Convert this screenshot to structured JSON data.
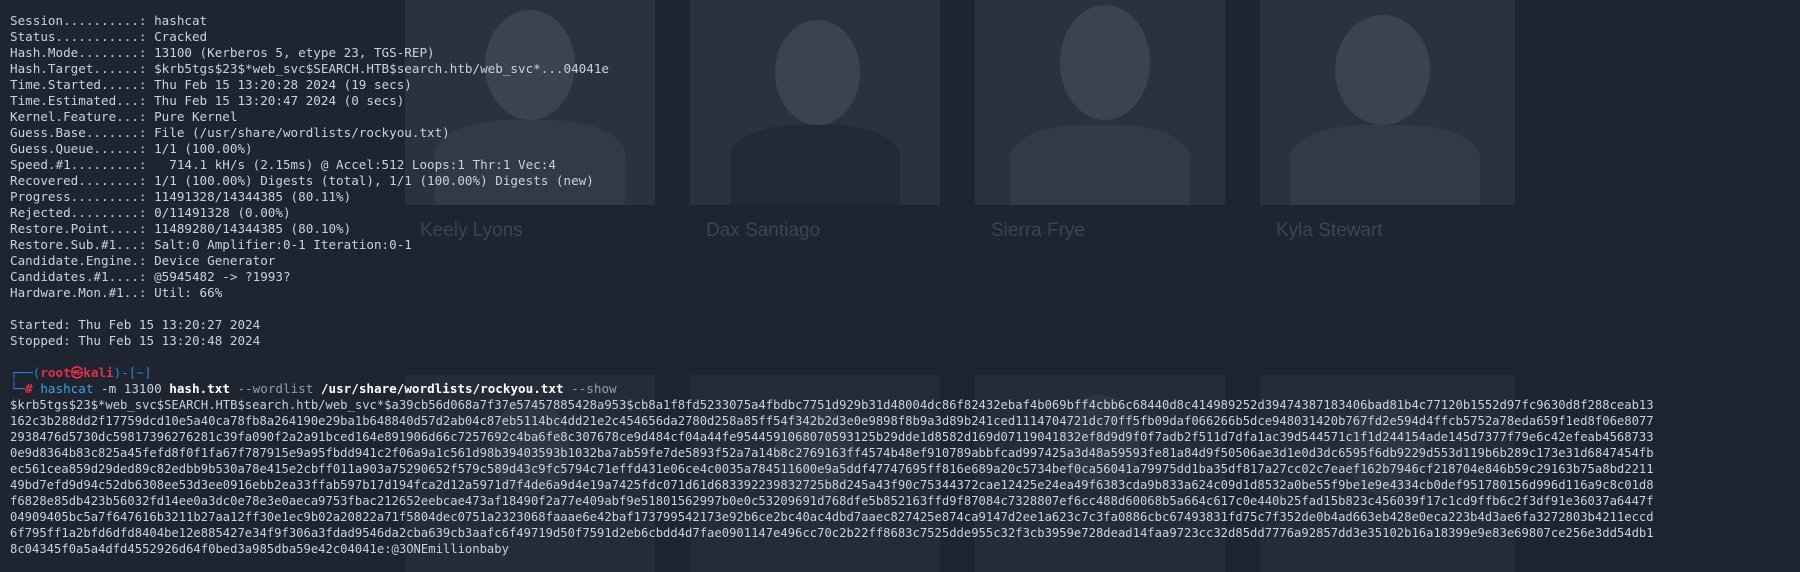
{
  "background": {
    "names": [
      "Keely Lyons",
      "Dax Santiago",
      "Sierra Frye",
      "Kyla Stewart"
    ]
  },
  "status_block": [
    {
      "label": "Session..........:",
      "value": " hashcat"
    },
    {
      "label": "Status...........:",
      "value": " Cracked"
    },
    {
      "label": "Hash.Mode........:",
      "value": " 13100 (Kerberos 5, etype 23, TGS-REP)"
    },
    {
      "label": "Hash.Target......:",
      "value": " $krb5tgs$23$*web_svc$SEARCH.HTB$search.htb/web_svc*...04041e"
    },
    {
      "label": "Time.Started.....:",
      "value": " Thu Feb 15 13:20:28 2024 (19 secs)"
    },
    {
      "label": "Time.Estimated...:",
      "value": " Thu Feb 15 13:20:47 2024 (0 secs)"
    },
    {
      "label": "Kernel.Feature...:",
      "value": " Pure Kernel"
    },
    {
      "label": "Guess.Base.......:",
      "value": " File (/usr/share/wordlists/rockyou.txt)"
    },
    {
      "label": "Guess.Queue......:",
      "value": " 1/1 (100.00%)"
    },
    {
      "label": "Speed.#1.........:",
      "value": "   714.1 kH/s (2.15ms) @ Accel:512 Loops:1 Thr:1 Vec:4"
    },
    {
      "label": "Recovered........:",
      "value": " 1/1 (100.00%) Digests (total), 1/1 (100.00%) Digests (new)"
    },
    {
      "label": "Progress.........:",
      "value": " 11491328/14344385 (80.11%)"
    },
    {
      "label": "Rejected.........:",
      "value": " 0/11491328 (0.00%)"
    },
    {
      "label": "Restore.Point....:",
      "value": " 11489280/14344385 (80.10%)"
    },
    {
      "label": "Restore.Sub.#1...:",
      "value": " Salt:0 Amplifier:0-1 Iteration:0-1"
    },
    {
      "label": "Candidate.Engine.:",
      "value": " Device Generator"
    },
    {
      "label": "Candidates.#1....:",
      "value": " @5945482 -> ?1993?"
    },
    {
      "label": "Hardware.Mon.#1..:",
      "value": " Util: 66%"
    }
  ],
  "timing": {
    "started": "Started: Thu Feb 15 13:20:27 2024",
    "stopped": "Stopped: Thu Feb 15 13:20:48 2024"
  },
  "prompt": {
    "open": "┌──(",
    "user_host": "root㉿kali",
    "close": ")-[~]",
    "arrow": "└─",
    "hash": "# "
  },
  "command": {
    "program": "hashcat",
    "mode_args": " -m 13100 ",
    "hashfile": "hash.txt",
    "wordlist_flag": " --wordlist ",
    "wordlist_path": "/usr/share/wordlists/rockyou.txt",
    "show_flag": " --show"
  },
  "output_lines": [
    "$krb5tgs$23$*web_svc$SEARCH.HTB$search.htb/web_svc*$a39cb56d068a7f37e57457885428a953$cb8a1f8fd5233075a4fbdbc7751d929b31d48004dc86f82432ebaf4b069bff4cbb6c68440d8c414989252d39474387183406bad81b4c77120b1552d97fc9630d8f288ceab13",
    "162c3b288dd2f17759dcd10e5a40ca78fb8a264190e29ba1b648840d57d2ab04c87eb5114bc4dd21e2c454656da2780d258a85ff54f342b2d3e0e9898f8b9a3d89b241ced1114704721dc70ff5fb09daf066266b5dce948031420b767fd2e594d4ffcb5752a78eda659f1ed8f06e8077",
    "2938476d5730dc59817396276281c39fa090f2a2a91bced164e891906d66c7257692c4ba6fe8c307678ce9d484cf04a44fe9544591068070593125b29dde1d8582d169d07119041832ef8d9d9f0f7adb2f511d7dfa1ac39d544571c1f1d244154ade145d7377f79e6c42efeab4568733",
    "0e9d8364b83c825a45fefd8f0f1fa67f787915e9a95fbdd941c2f06a9a1c561d98b39403593b1032ba7ab59fe7de5893f52a7a14b8c2769163ff4574b48ef910789abbfcad997425a3d48a59593fe81a84d9f50506ae3d1e0d3dc6595f6db9229d553d119b6b289c173e31d6847454fb",
    "ec561cea859d29ded89c82edbb9b530a78e415e2cbff011a903a75290652f579c589d43c9fc5794c71effd431e06ce4c0035a784511600e9a5ddf47747695ff816e689a20c5734bef0ca56041a79975dd1ba35df817a27cc02c7eaef162b7946cf218704e846b59c29163b75a8bd2211",
    "49bd7efd9d94c52db6308ee53d3ee0916ebb2ea33ffab597b17d194fca2d12a5971d7f4de6a9d4e19a7425fdc071d61d683392239832725b8d245a43f90c75344372cae12425e24ea49f6383cda9b833a624c09d1d8532a0be55f9be1e9e4334cb0def951780156d996d116a9c8c01d8",
    "f6828e85db423b56032fd14ee0a3dc0e78e3e0aeca9753fbac212652eebcae473af18490f2a77e409abf9e51801562997b0e0c53209691d768dfe5b852163ffd9f87084c7328807ef6cc488d60068b5a664c617c0e440b25fad15b823c456039f17c1cd9ffb6c2f3df91e36037a6447f",
    "04909405bc5a7f647616b3211b27aa12ff30e1ec9b02a20822a71f5804dec0751a2323068faaae6e42baf173799542173e92b6ce2bc40ac4dbd7aaec827425e874ca9147d2ee1a623c7c3fa0886cbc67493831fd75c7f352de0b4ad663eb428e0eca223b4d3ae6fa3272803b4211eccd",
    "6f795ff1a2bfd6dfd8404be12e885427e34f9f306a3fdad9546da2cba639cb3aafc6f49719d50f7591d2eb6cbdd4d7fae0901147e496cc70c2b22ff8683c7525dde955c32f3cb3959e728dead14faa9723cc32d85dd7776a92857dd3e35102b16a18399e9e83e69807ce256e3dd54db1",
    "8c04345f0a5a4dfd4552926d64f0bed3a985dba59e42c04041e:@3ONEmillionbaby"
  ]
}
